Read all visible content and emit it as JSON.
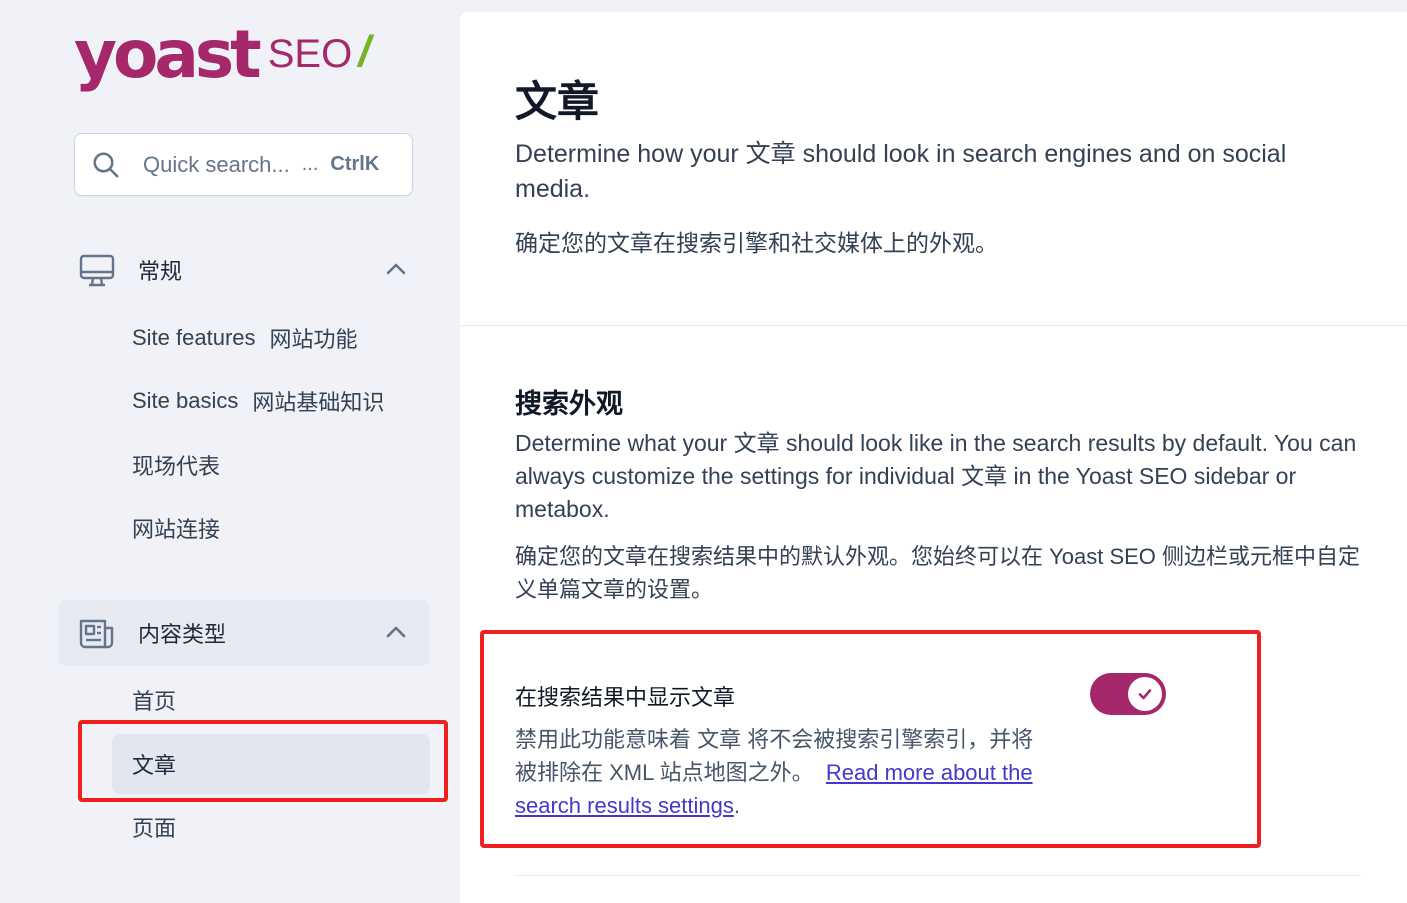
{
  "brand": {
    "wordmark": "yoast",
    "product": "SEO",
    "slash": "/",
    "color": "#a4286a",
    "accent": "#77b227"
  },
  "search": {
    "placeholder": "Quick search...",
    "ellipsis": "...",
    "shortcut": "CtrlK"
  },
  "sidebar": {
    "groups": [
      {
        "label": "常规",
        "icon": "desktop-icon",
        "expanded": true,
        "items": [
          {
            "label": "Site features",
            "label_zh": "网站功能"
          },
          {
            "label": "Site basics",
            "label_zh": "网站基础知识"
          },
          {
            "label": "现场代表"
          },
          {
            "label": "网站连接"
          }
        ]
      },
      {
        "label": "内容类型",
        "icon": "newspaper-icon",
        "expanded": true,
        "items": [
          {
            "label": "首页"
          },
          {
            "label": "文章",
            "active": true
          },
          {
            "label": "页面"
          }
        ]
      }
    ]
  },
  "main": {
    "title": "文章",
    "description": "Determine how your 文章 should look in search engines and on social media.",
    "description_zh": "确定您的文章在搜索引擎和社交媒体上的外观。",
    "section": {
      "title": "搜索外观",
      "description": "Determine what your 文章 should look like in the search results by default. You can always customize the settings for individual 文章 in the Yoast SEO sidebar or metabox.",
      "description_zh": "确定您的文章在搜索结果中的默认外观。您始终可以在 Yoast SEO 侧边栏或元框中自定义单篇文章的设置。"
    },
    "setting": {
      "label": "在搜索结果中显示文章",
      "description": "禁用此功能意味着 文章 将不会被搜索引擎索引，并将被排除在 XML 站点地图之外。",
      "link_text": "Read more about the search results settings",
      "link_suffix": ".",
      "toggle_on": true,
      "toggle_color": "#a4286a"
    }
  },
  "highlight_color": "#ef2020"
}
